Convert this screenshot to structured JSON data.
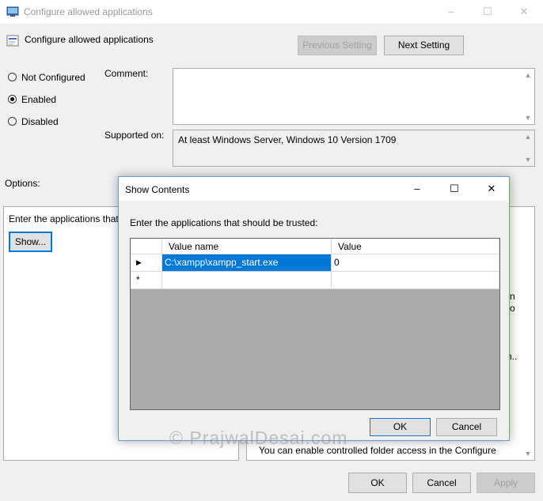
{
  "window": {
    "title": "Configure allowed applications",
    "controls": [
      "–",
      "☐",
      "✕"
    ]
  },
  "header": {
    "policy_name": "Configure allowed applications",
    "prev_label": "Previous Setting",
    "next_label": "Next Setting"
  },
  "state": {
    "options": [
      "Not Configured",
      "Enabled",
      "Disabled"
    ],
    "selected": "Enabled"
  },
  "comment": {
    "label": "Comment:",
    "value": ""
  },
  "supported": {
    "label": "Supported on:",
    "value": "At least Windows Server, Windows 10 Version 1709"
  },
  "options_panel": {
    "label": "Options:",
    "text": "Enter the applications that",
    "show_label": "Show..."
  },
  "help_panel": {
    "fragments": [
      "n",
      "o",
      "n.."
    ],
    "visible_line": "You can enable controlled folder access in the Configure"
  },
  "footer": {
    "ok_label": "OK",
    "cancel_label": "Cancel",
    "apply_label": "Apply"
  },
  "dialog": {
    "title": "Show Contents",
    "controls": [
      "–",
      "☐",
      "✕"
    ],
    "prompt": "Enter the applications that should be trusted:",
    "columns": [
      "Value name",
      "Value"
    ],
    "rows": [
      {
        "marker": "▶",
        "name": "C:\\xampp\\xampp_start.exe",
        "value": "0"
      },
      {
        "marker": "*",
        "name": "",
        "value": ""
      }
    ],
    "ok_label": "OK",
    "cancel_label": "Cancel"
  },
  "watermark": "© PrajwalDesai.com"
}
